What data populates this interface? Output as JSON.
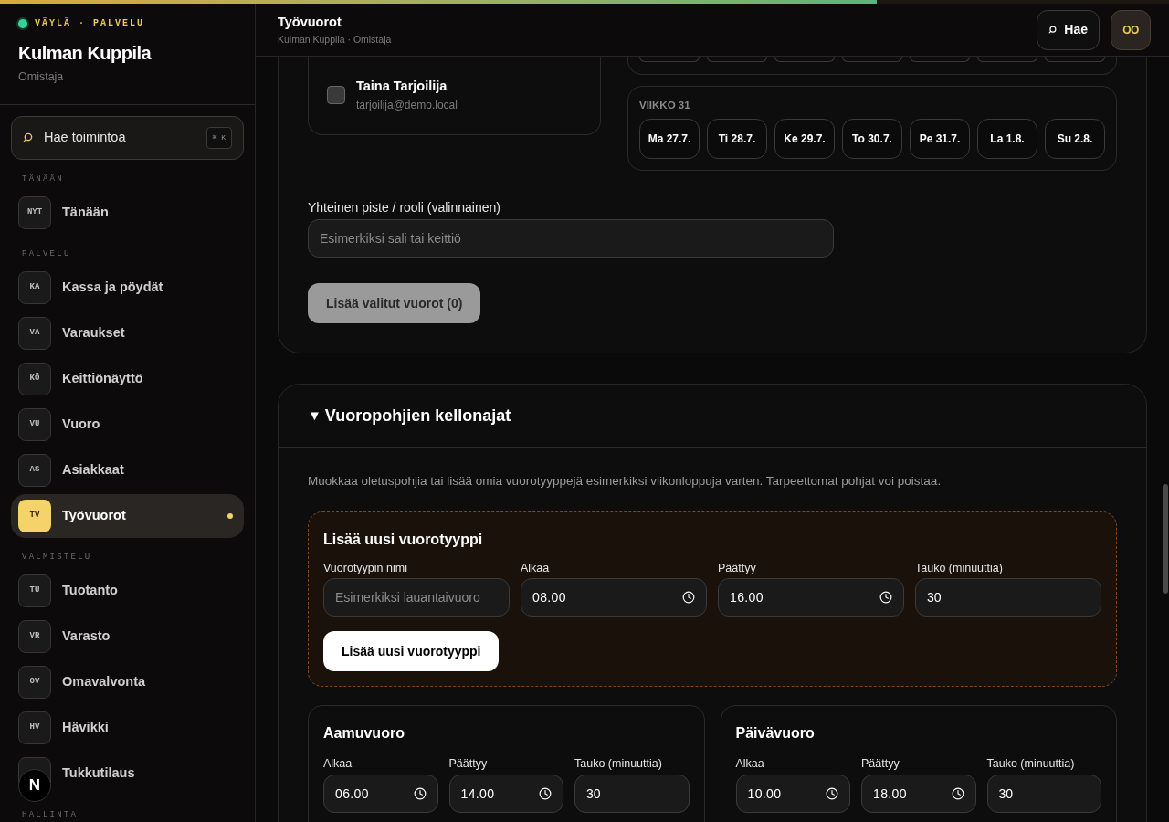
{
  "progress": {
    "level": 0.75
  },
  "sidebar": {
    "brand": [
      "VÄYLÄ",
      "·",
      "PALVELU"
    ],
    "title": "Kulman Kuppila",
    "subtitle": "Omistaja",
    "search": {
      "placeholder": "Hae toimintoa",
      "shortcut": "⌘ K"
    },
    "sections": [
      {
        "heading": "TÄNÄÄN",
        "items": [
          {
            "badge": "NYT",
            "label": "Tänään",
            "selected": false
          }
        ]
      },
      {
        "heading": "PALVELU",
        "items": [
          {
            "badge": "KA",
            "label": "Kassa ja pöydät",
            "selected": false
          },
          {
            "badge": "VA",
            "label": "Varaukset",
            "selected": false
          },
          {
            "badge": "KÖ",
            "label": "Keittiönäyttö",
            "selected": false
          },
          {
            "badge": "VU",
            "label": "Vuoro",
            "selected": false
          },
          {
            "badge": "AS",
            "label": "Asiakkaat",
            "selected": false
          },
          {
            "badge": "TV",
            "label": "Työvuorot",
            "selected": true
          }
        ]
      },
      {
        "heading": "VALMISTELU",
        "items": [
          {
            "badge": "TU",
            "label": "Tuotanto",
            "selected": false
          },
          {
            "badge": "VR",
            "label": "Varasto",
            "selected": false
          },
          {
            "badge": "OV",
            "label": "Omavalvonta",
            "selected": false
          },
          {
            "badge": "HV",
            "label": "Hävikki",
            "selected": false
          },
          {
            "label": "Tukkutilaus",
            "selected": false
          }
        ]
      },
      {
        "heading": "HALLINTA"
      }
    ],
    "dev_badge": "N"
  },
  "header": {
    "title": "Työvuorot",
    "subtitle": "Kulman Kuppila · Omistaja",
    "search_button": "Hae",
    "avatar": "OO"
  },
  "employees": [
    {
      "name": "Taina Tarjoilija",
      "email": "tarjoilija@demo.local",
      "checked": false
    }
  ],
  "weeks": [
    {
      "label": "VIIKKO 31",
      "days": [
        {
          "label": "Ma 27.7.",
          "selected": false
        },
        {
          "label": "Ti 28.7.",
          "selected": false
        },
        {
          "label": "Ke 29.7.",
          "selected": false
        },
        {
          "label": "To 30.7.",
          "selected": false
        },
        {
          "label": "Pe 31.7.",
          "selected": false
        },
        {
          "label": "La 1.8.",
          "selected": false
        },
        {
          "label": "Su 2.8.",
          "selected": false
        }
      ]
    }
  ],
  "role_field": {
    "label": "Yhteinen piste / rooli (valinnainen)",
    "placeholder": "Esimerkiksi sali tai keittiö"
  },
  "add_button": {
    "label": "Lisää valitut vuorot (0)",
    "disabled": true
  },
  "templates_section": {
    "marker": "▼",
    "title": "Vuoropohjien kellonajat",
    "description": "Muokkaa oletuspohjia tai lisää omia vuorotyyppejä esimerkiksi viikonloppuja varten. Tarpeettomat pohjat voi poistaa.",
    "new_type": {
      "title": "Lisää uusi vuorotyyppi",
      "fields": [
        {
          "kind": "text",
          "label": "Vuorotyypin nimi",
          "placeholder": "Esimerkiksi lauantaivuoro"
        },
        {
          "kind": "time",
          "label": "Alkaa",
          "value": "08.00"
        },
        {
          "kind": "time",
          "label": "Päättyy",
          "value": "16.00"
        },
        {
          "kind": "number",
          "label": "Tauko (minuuttia)",
          "value": "30"
        }
      ],
      "button": "Lisää uusi vuorotyyppi"
    },
    "templates": [
      {
        "name": "Aamuvuoro",
        "fields": [
          {
            "kind": "time",
            "label": "Alkaa",
            "value": "06.00"
          },
          {
            "kind": "time",
            "label": "Päättyy",
            "value": "14.00"
          },
          {
            "kind": "number",
            "label": "Tauko (minuuttia)",
            "value": "30"
          }
        ]
      },
      {
        "name": "Päivävuoro",
        "fields": [
          {
            "kind": "time",
            "label": "Alkaa",
            "value": "10.00"
          },
          {
            "kind": "time",
            "label": "Päättyy",
            "value": "18.00"
          },
          {
            "kind": "number",
            "label": "Tauko (minuuttia)",
            "value": "30"
          }
        ]
      }
    ]
  }
}
